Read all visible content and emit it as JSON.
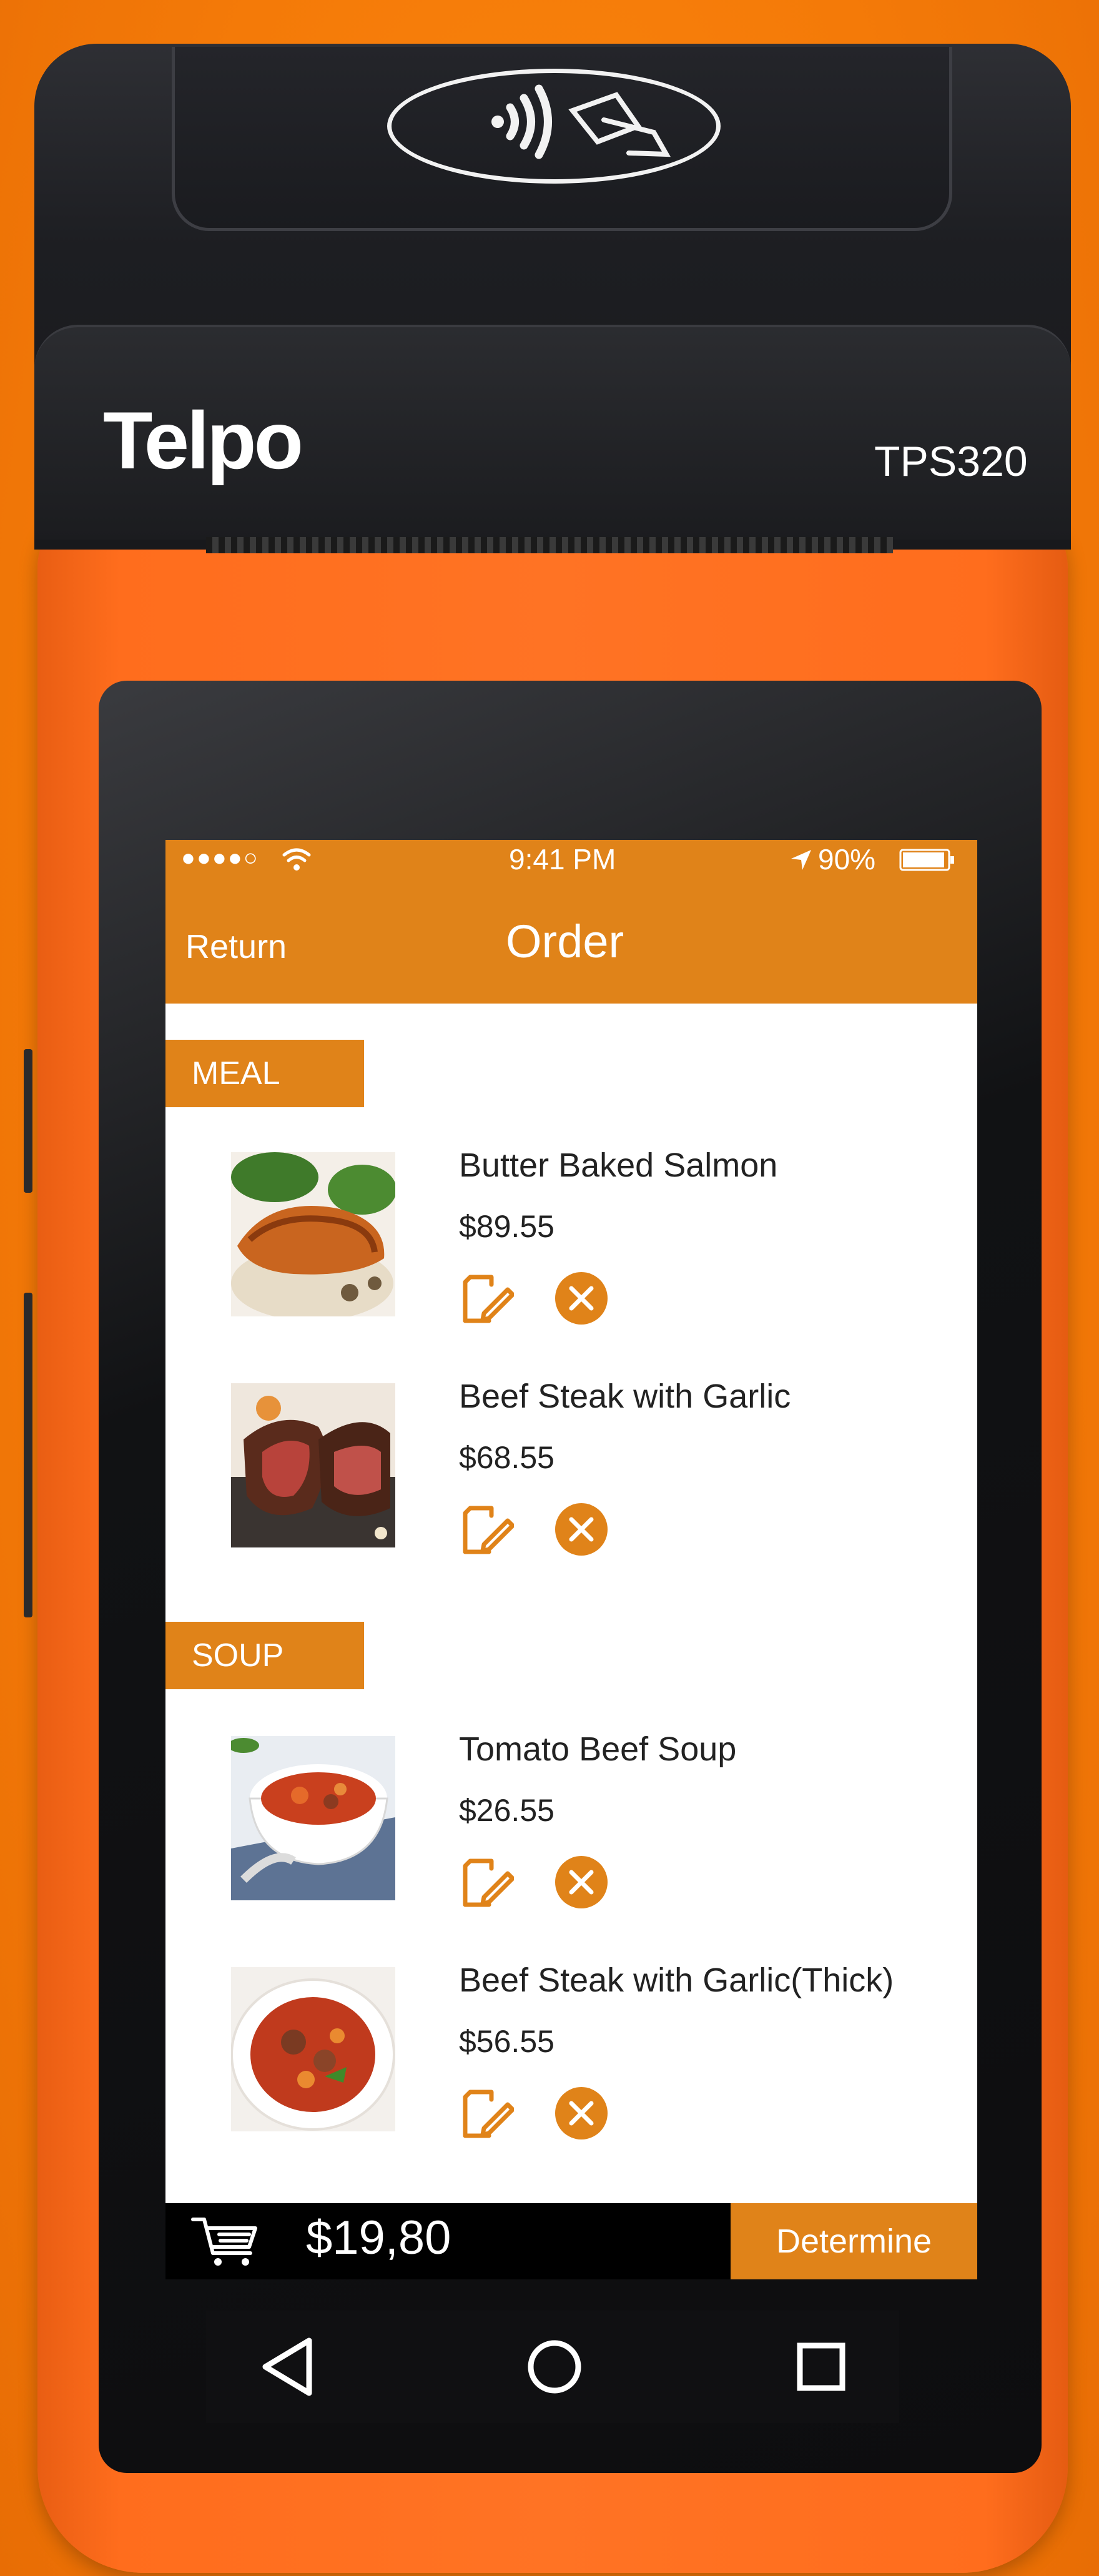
{
  "device": {
    "brand": "Telpo",
    "model": "TPS320"
  },
  "status_bar": {
    "signal": "●●●●○",
    "time": "9:41 PM",
    "battery": "90%"
  },
  "header": {
    "return_label": "Return",
    "title": "Order"
  },
  "sections": [
    {
      "label": "MEAL",
      "items": [
        {
          "name": "Butter Baked Salmon",
          "price": "$89.55"
        },
        {
          "name": "Beef Steak with Garlic",
          "price": "$68.55"
        }
      ]
    },
    {
      "label": "SOUP",
      "items": [
        {
          "name": "Tomato Beef Soup",
          "price": "$26.55"
        },
        {
          "name": "Beef Steak with Garlic(Thick)",
          "price": "$56.55"
        }
      ]
    }
  ],
  "footer": {
    "total": "$19,80",
    "determine_label": "Determine"
  },
  "colors": {
    "accent": "#e08319",
    "device_orange": "#ff7324",
    "device_dark": "#1d1e22"
  },
  "icons": {
    "nfc": "nfc-icon",
    "edit": "edit-icon",
    "remove": "remove-icon",
    "cart": "cart-icon",
    "back": "nav-back-icon",
    "home": "nav-home-icon",
    "recents": "nav-recents-icon"
  }
}
